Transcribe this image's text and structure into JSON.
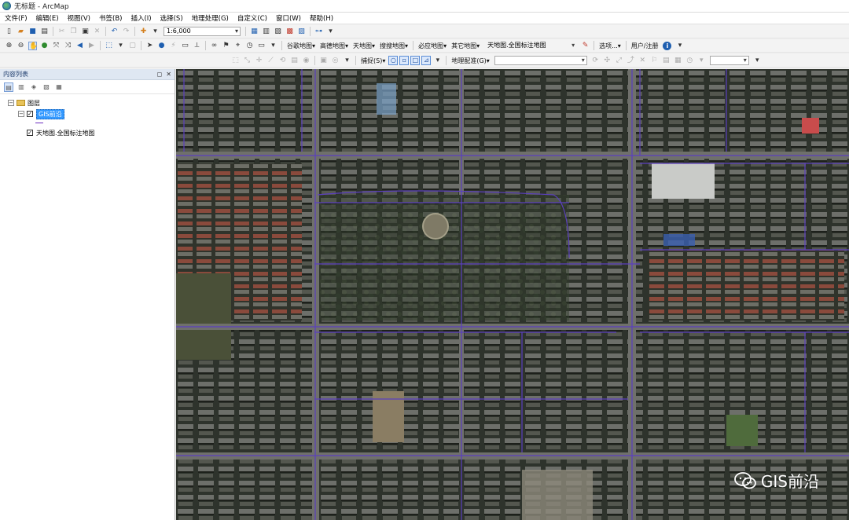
{
  "window": {
    "title": "无标题 - ArcMap",
    "app_icon": "arcmap-globe-icon"
  },
  "menu": {
    "items": [
      "文件(F)",
      "编辑(E)",
      "视图(V)",
      "书签(B)",
      "插入(I)",
      "选择(S)",
      "地理处理(G)",
      "自定义(C)",
      "窗口(W)",
      "帮助(H)"
    ]
  },
  "toolbar": {
    "scale_value": "1:6,000",
    "basemap_buttons": [
      "谷歌地图",
      "高德地图",
      "天地图",
      "搜搜地图",
      "必应地图",
      "其它地图"
    ],
    "basemap_select": "天地图.全国标注地图",
    "options_label": "选项...",
    "user_label": "用户/注册",
    "snapping_label": "捕捉(S)",
    "georef_label": "地理配准(G)",
    "georef_layer_value": ""
  },
  "toc": {
    "title": "内容列表",
    "root_label": "图层",
    "layers": [
      {
        "name": "GIS前沿",
        "checked": true,
        "selected": true
      },
      {
        "name": "天地图.全国标注地图",
        "checked": true,
        "selected": false
      }
    ],
    "legend_color": "#6a2bbf"
  },
  "map": {
    "road_line_color": "#5b3fbf",
    "imagery": "satellite"
  },
  "watermark": {
    "text": "GIS前沿",
    "icon": "wechat-icon"
  }
}
